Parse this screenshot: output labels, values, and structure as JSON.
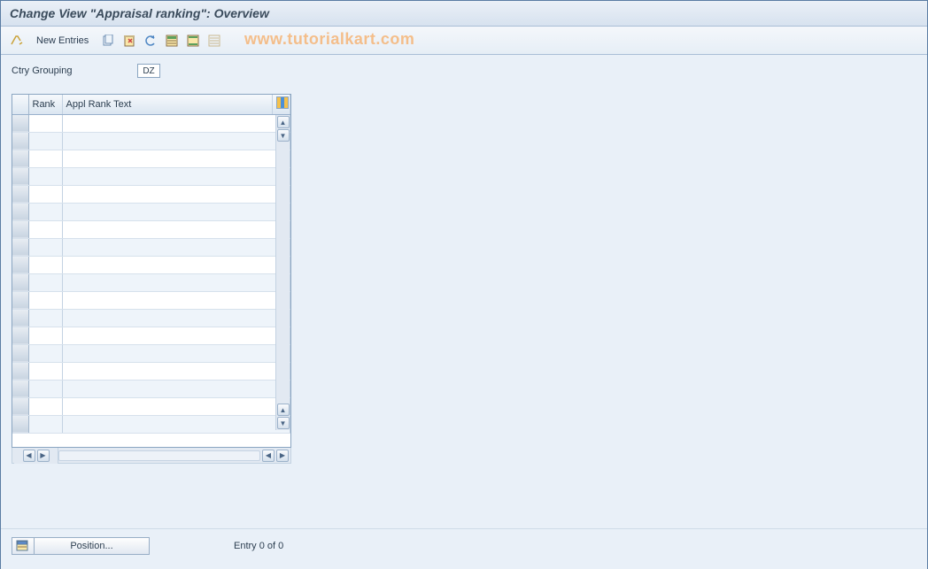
{
  "title": "Change View \"Appraisal ranking\": Overview",
  "toolbar": {
    "new_entries": "New Entries"
  },
  "watermark": "www.tutorialkart.com",
  "field": {
    "label": "Ctry Grouping",
    "value": "DZ"
  },
  "table": {
    "col_rank": "Rank",
    "col_text": "Appl Rank Text",
    "rows": [
      "",
      "",
      "",
      "",
      "",
      "",
      "",
      "",
      "",
      "",
      "",
      "",
      "",
      "",
      "",
      "",
      "",
      ""
    ]
  },
  "footer": {
    "position_label": "Position...",
    "entry_label": "Entry 0 of 0"
  }
}
